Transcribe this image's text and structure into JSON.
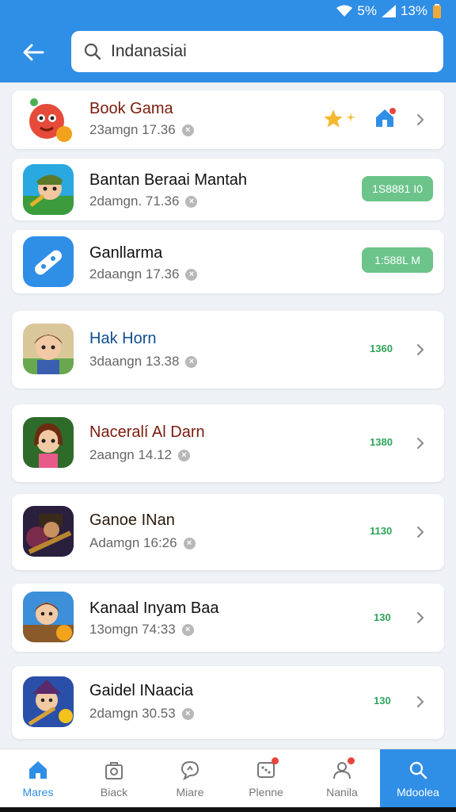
{
  "status": {
    "signal": "5%",
    "battery": "13%"
  },
  "search": {
    "value": "Indanasiai"
  },
  "items": [
    {
      "title": "Book Gama",
      "sub": "23amgn 17.36",
      "title_color": "#7a1b0c"
    },
    {
      "title": "Bantan Beraai Mantah",
      "sub": "2damgn. 71.36",
      "badge": "1S8881 I0",
      "title_color": "#111111"
    },
    {
      "title": "Ganllarma",
      "sub": "2daangn 17.36",
      "badge": "1:588L M",
      "title_color": "#111111"
    },
    {
      "title": "Hak Horn",
      "sub": "3daangn 13.38",
      "value": "1360",
      "title_color": "#0f4f8f"
    },
    {
      "title": "Naceralí Al Darn",
      "sub": "2aangn 14.12",
      "value": "1380",
      "title_color": "#7a1b0c"
    },
    {
      "title": "Ganoe INan",
      "sub": "Adamgn 16:26",
      "value": "1130",
      "title_color": "#2a1a0a"
    },
    {
      "title": "Kanaal Inyam Baa",
      "sub": "13omgn 74:33",
      "value": "130",
      "title_color": "#111111"
    },
    {
      "title": "Gaidel INaacia",
      "sub": "2damgn 30.53",
      "value": "130",
      "title_color": "#111111"
    }
  ],
  "nav": [
    {
      "label": "Mares",
      "icon": "home-icon"
    },
    {
      "label": "Biack",
      "icon": "bag-icon"
    },
    {
      "label": "Miare",
      "icon": "chat-icon"
    },
    {
      "label": "Plenne",
      "icon": "dice-icon"
    },
    {
      "label": "Nanila",
      "icon": "user-icon"
    },
    {
      "label": "Mdoolea",
      "icon": "search-icon"
    }
  ],
  "colors": {
    "accent": "#2f8ee6",
    "value_green": "#2fa45a",
    "pill_green": "#6cc48b"
  }
}
